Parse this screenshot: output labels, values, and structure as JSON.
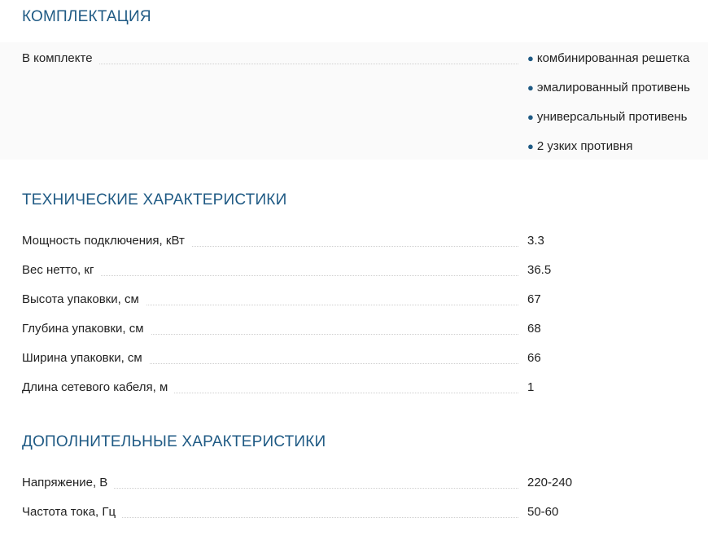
{
  "sections": {
    "kit": {
      "title": "КОМПЛЕКТАЦИЯ",
      "label": "В комплекте",
      "items": [
        "комбинированная решетка",
        "эмалированный противень",
        "универсальный противень",
        "2 узких противня"
      ]
    },
    "tech": {
      "title": "ТЕХНИЧЕСКИЕ ХАРАКТЕРИСТИКИ",
      "rows": [
        {
          "label": "Мощность подключения, кВт",
          "value": "3.3"
        },
        {
          "label": "Вес нетто, кг",
          "value": "36.5"
        },
        {
          "label": "Высота упаковки, см",
          "value": "67"
        },
        {
          "label": "Глубина упаковки, см",
          "value": "68"
        },
        {
          "label": "Ширина упаковки, см",
          "value": "66"
        },
        {
          "label": "Длина сетевого кабеля, м",
          "value": "1"
        }
      ]
    },
    "extra": {
      "title": "ДОПОЛНИТЕЛЬНЫЕ ХАРАКТЕРИСТИКИ",
      "rows": [
        {
          "label": "Напряжение, В",
          "value": "220-240"
        },
        {
          "label": "Частота тока, Гц",
          "value": "50-60"
        }
      ]
    }
  },
  "colors": {
    "heading": "#1f5a84",
    "bullet": "#1f5a84",
    "text": "#222222",
    "kit_background": "#fafafa"
  }
}
